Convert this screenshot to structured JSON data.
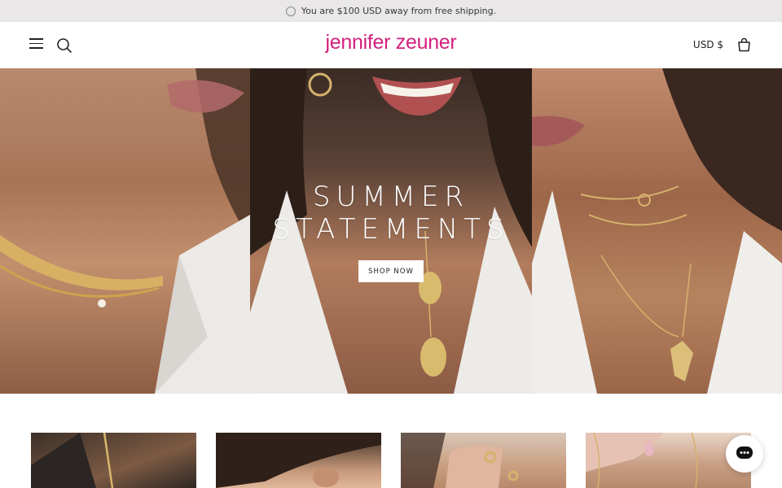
{
  "announcement": {
    "text": "You are $100 USD away from free shipping.",
    "icon": "progress-ring-icon"
  },
  "header": {
    "logo": "jennifer zeuner",
    "currency": "USD $",
    "brand_color": "#d4207d",
    "icons": [
      "menu-icon",
      "search-icon",
      "cart-icon"
    ]
  },
  "hero": {
    "title_line1": "SUMMER",
    "title_line2": "STATEMENTS",
    "cta_label": "SHOP NOW",
    "panels": [
      "gold-choker-portrait",
      "smiling-lariat-portrait",
      "layered-chains-portrait"
    ]
  },
  "products": [
    {
      "name": "product-tile-1"
    },
    {
      "name": "product-tile-2"
    },
    {
      "name": "product-tile-3"
    },
    {
      "name": "product-tile-4"
    }
  ],
  "chat": {
    "icon": "chat-icon"
  }
}
